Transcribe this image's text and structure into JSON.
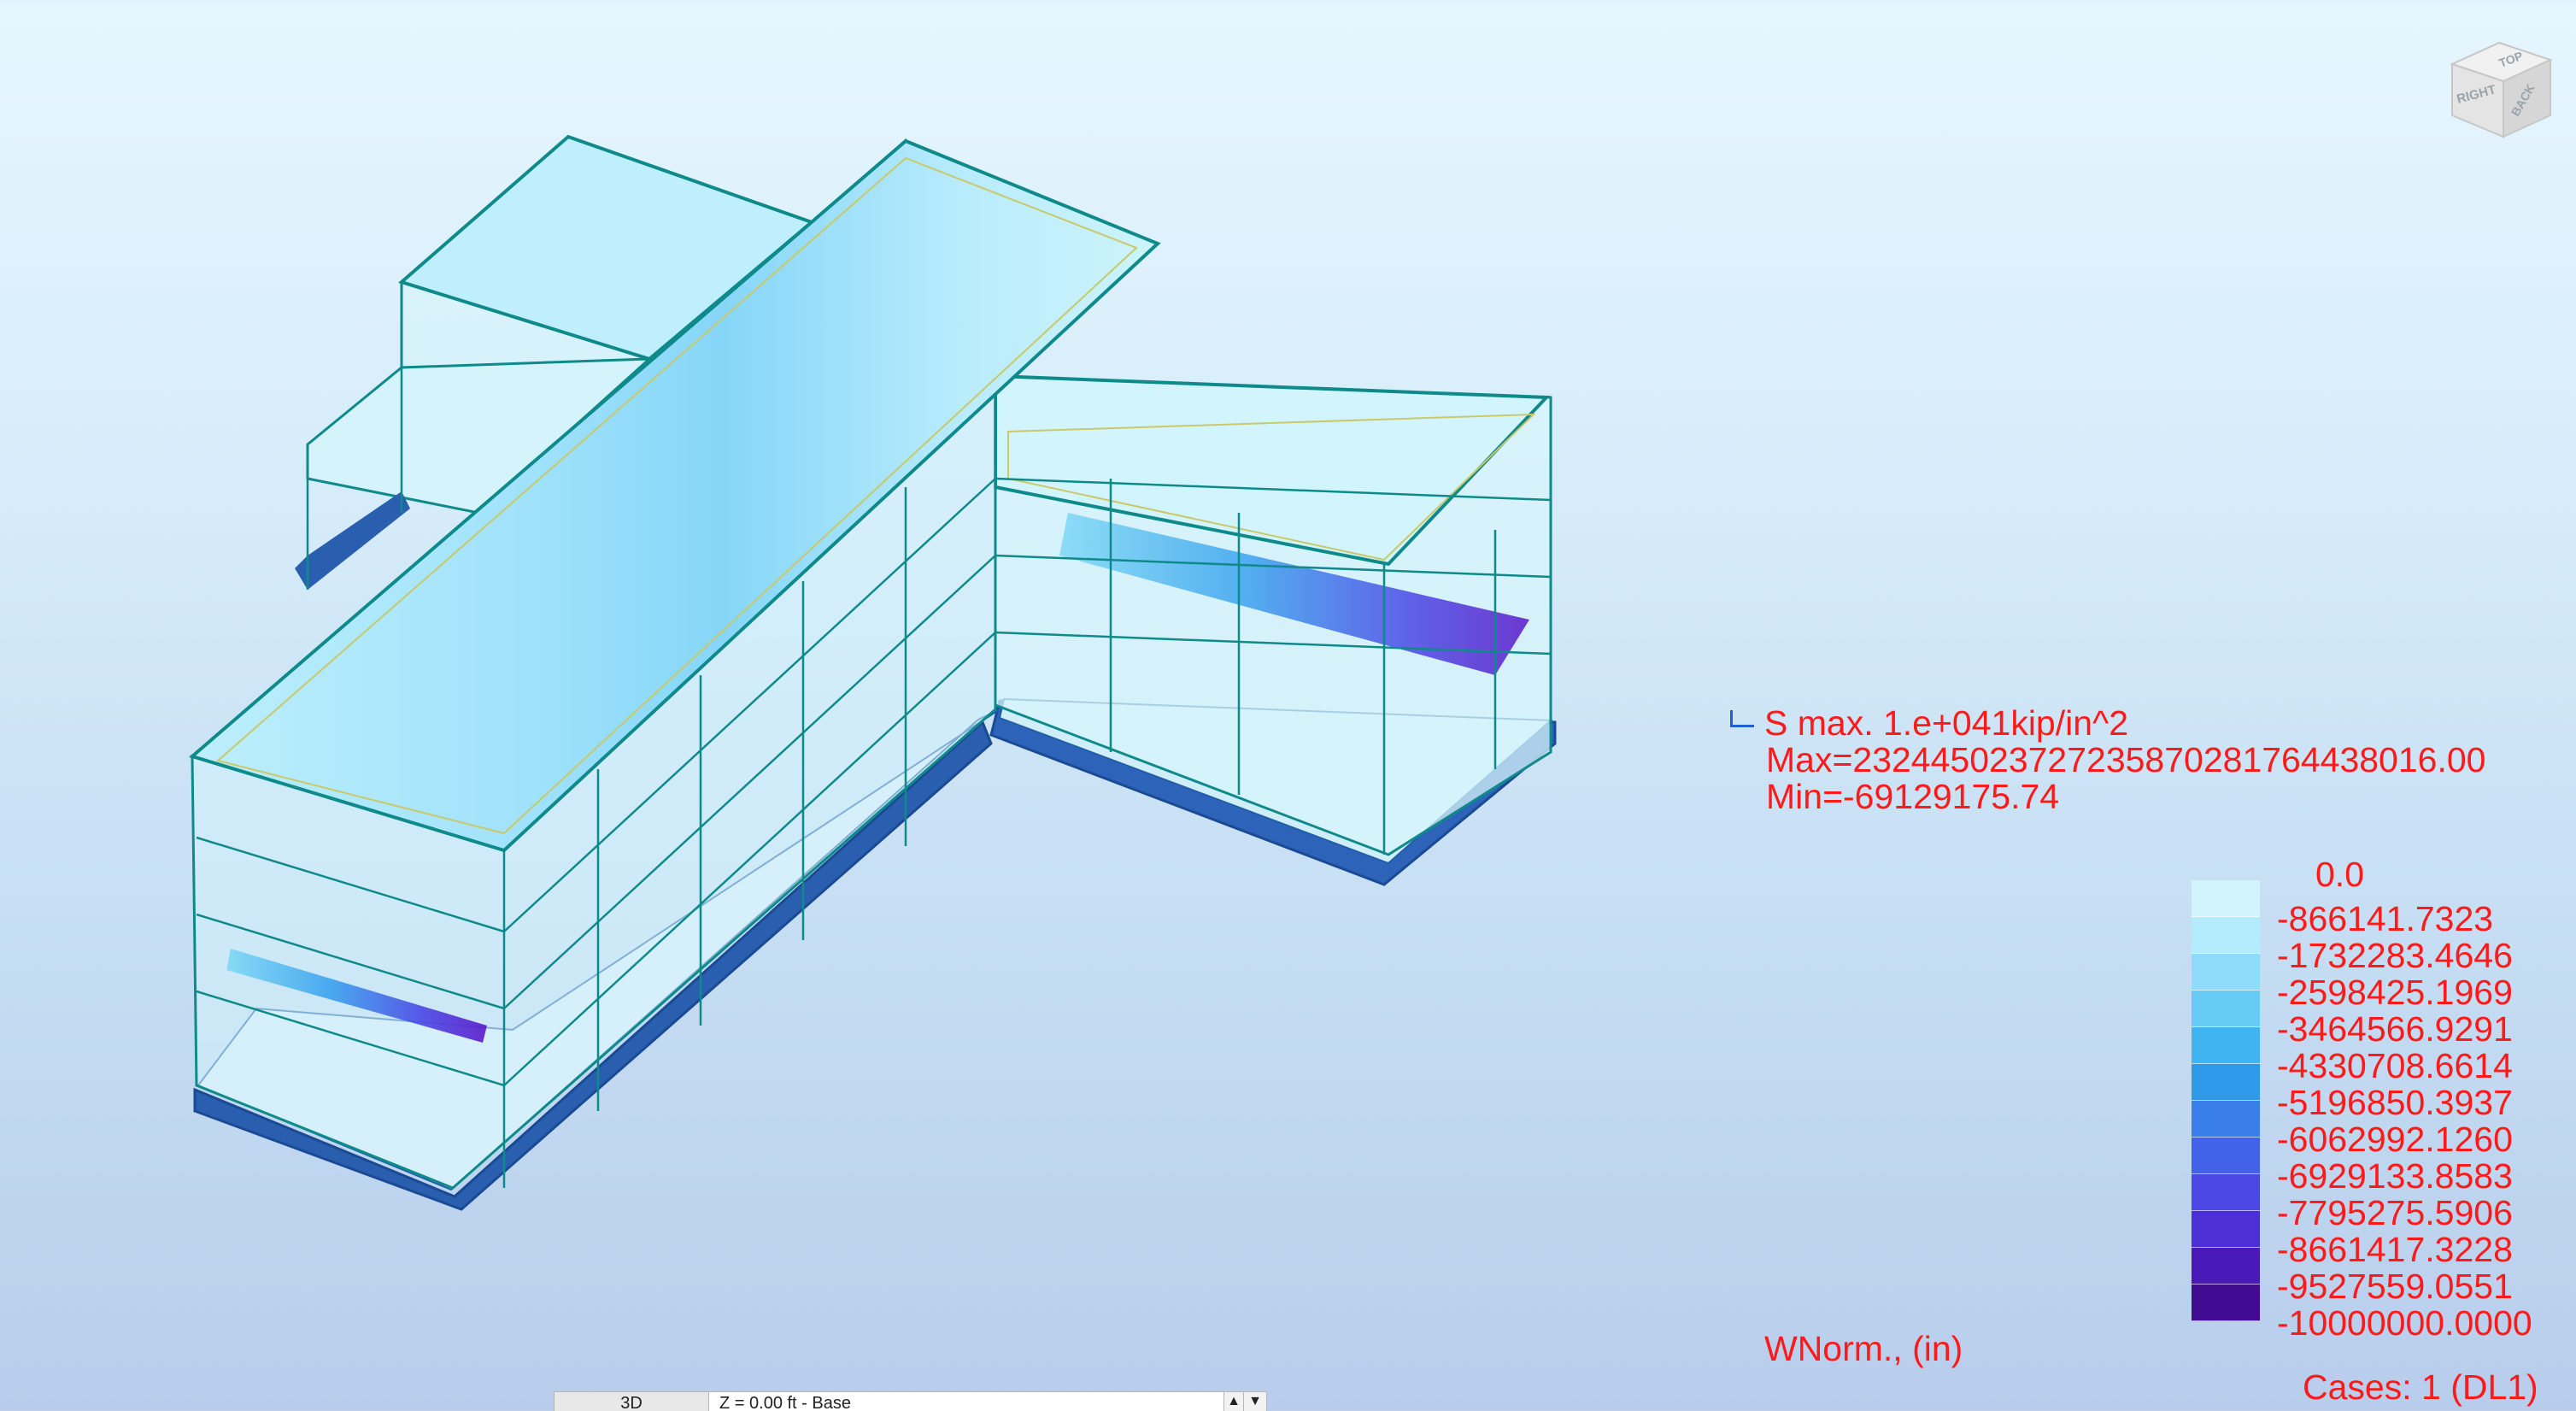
{
  "result_header": {
    "title": "S max. 1.e+041kip/in^2",
    "max": "Max=232445023727235870281764438016.00",
    "min": "Min=-69129175.74"
  },
  "legend": {
    "top_value": "0.0",
    "items": [
      {
        "label": "-866141.7323",
        "color": "#d2f5fd"
      },
      {
        "label": "-1732283.4646",
        "color": "#b3ecfc"
      },
      {
        "label": "-2598425.1969",
        "color": "#8fdcfa"
      },
      {
        "label": "-3464566.9291",
        "color": "#67cbf5"
      },
      {
        "label": "-4330708.6614",
        "color": "#3fb4f0"
      },
      {
        "label": "-5196850.3937",
        "color": "#2f9ae9"
      },
      {
        "label": "-6062992.1260",
        "color": "#3a7eea"
      },
      {
        "label": "-6929133.8583",
        "color": "#4362ea"
      },
      {
        "label": "-7795275.5906",
        "color": "#4a47e4"
      },
      {
        "label": "-8661417.3228",
        "color": "#4d2fd6"
      },
      {
        "label": "-9527559.0551",
        "color": "#4a1ab8"
      },
      {
        "label": "-10000000.0000",
        "color": "#420c92"
      }
    ]
  },
  "quantity_label": "WNorm., (in)",
  "cases_label": "Cases: 1 (DL1)",
  "view_cube": {
    "faces": {
      "top": "TOP",
      "right": "RIGHT",
      "back": "BACK"
    }
  },
  "bottom_bar": {
    "view": "3D",
    "level": "Z = 0.00 ft - Base"
  },
  "colors": {
    "accent_text": "#ff1a1a",
    "frame_lines": "#0f8a8a",
    "slab_light": "#cdf4fb",
    "slab_mid": "#86d6f8",
    "slab_dark": "#1b5aa6"
  }
}
